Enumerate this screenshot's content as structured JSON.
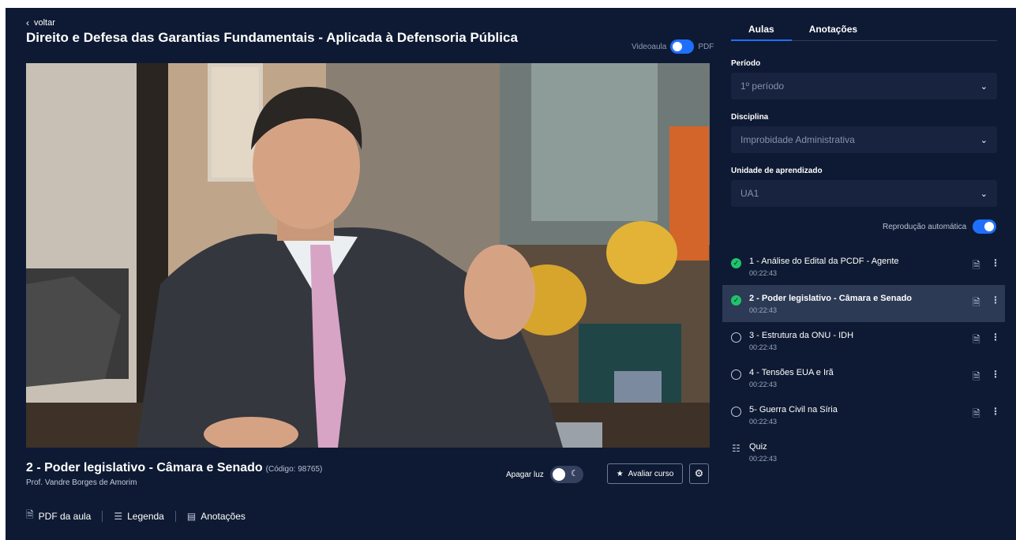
{
  "header": {
    "back_label": "voltar",
    "course_title": "Direito e Defesa das Garantias Fundamentais - Aplicada à Defensoria Pública",
    "mode_video_label": "Videoaula",
    "mode_pdf_label": "PDF"
  },
  "lesson": {
    "title": "2 - Poder legislativo - Câmara e Senado",
    "code": "(Código: 98765)",
    "professor": "Prof. Vandre Borges de Amorim",
    "lights_off_label": "Apagar luz",
    "rate_label": "Avaliar curso"
  },
  "footer_links": [
    {
      "label": "PDF da aula",
      "icon": "pdf-file-icon"
    },
    {
      "label": "Legenda",
      "icon": "subtitles-icon"
    },
    {
      "label": "Anotações",
      "icon": "notes-icon"
    }
  ],
  "sidebar": {
    "tabs": [
      {
        "label": "Aulas",
        "active": true
      },
      {
        "label": "Anotações",
        "active": false
      }
    ],
    "period": {
      "label": "Período",
      "value": "1º período"
    },
    "discipline": {
      "label": "Disciplina",
      "value": "Improbidade Administrativa"
    },
    "unit": {
      "label": "Unidade de aprendizado",
      "value": "UA1"
    },
    "autoplay_label": "Reprodução automática",
    "lessons": [
      {
        "name": "1 - Análise do Edital da PCDF - Agente",
        "duration": "00:22:43",
        "status": "done"
      },
      {
        "name": "2 - Poder legislativo - Câmara e Senado",
        "duration": "00:22:43",
        "status": "done",
        "active": true
      },
      {
        "name": "3 - Estrutura da ONU - IDH",
        "duration": "00:22:43",
        "status": "todo"
      },
      {
        "name": "4 - Tensões EUA e Irã",
        "duration": "00:22:43",
        "status": "todo"
      },
      {
        "name": "5- Guerra Civil na Síria",
        "duration": "00:22:43",
        "status": "todo"
      },
      {
        "name": "Quiz",
        "duration": "00:22:43",
        "status": "quiz"
      }
    ]
  },
  "colors": {
    "background": "#0e1a33",
    "accent": "#1f6fff",
    "done": "#1fc46a",
    "active_row": "#2c3a55"
  }
}
